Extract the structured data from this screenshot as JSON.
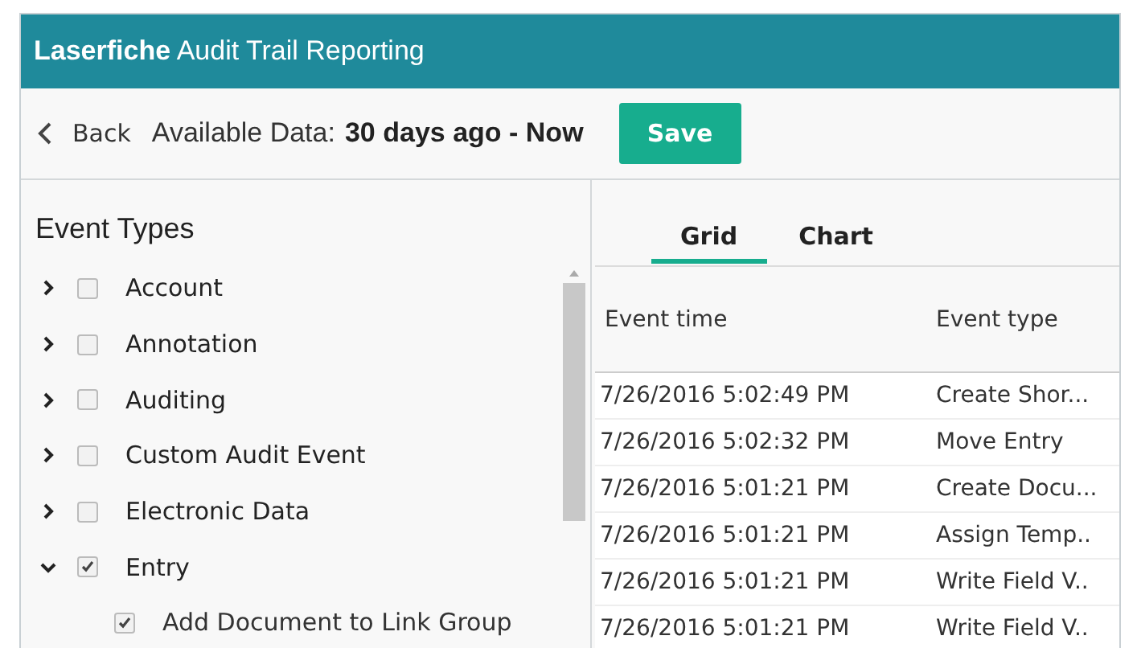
{
  "window": {
    "title": "**Laserfiche** Audit Trail Reporting"
  },
  "toolbar": {
    "back": "Back",
    "range_label": "Available Data:",
    "range_value": "30 days ago - Now",
    "save": "Save"
  },
  "event_types": {
    "title": "Event Types",
    "items": [
      {
        "label": "Account",
        "expanded": false,
        "checked": false
      },
      {
        "label": "Annotation",
        "expanded": false,
        "checked": false
      },
      {
        "label": "Auditing",
        "expanded": false,
        "checked": false
      },
      {
        "label": "Custom Audit Event",
        "expanded": false,
        "checked": false
      },
      {
        "label": "Electronic Data",
        "expanded": false,
        "checked": false
      },
      {
        "label": "Entry",
        "expanded": true,
        "checked": true,
        "children": [
          {
            "label": "Add Document to Link Group",
            "checked": true
          }
        ]
      }
    ]
  },
  "tabs": [
    {
      "label": "Grid",
      "selected": true
    },
    {
      "label": "Chart",
      "selected": false
    }
  ],
  "table": {
    "columns": [
      "Event time",
      "Event type"
    ],
    "rows": [
      [
        "7/26/2016 5:02:49 PM",
        "Create Shor..."
      ],
      [
        "7/26/2016 5:02:32 PM",
        "Move Entry"
      ],
      [
        "7/26/2016 5:01:21 PM",
        "Create Docu..."
      ],
      [
        "7/26/2016 5:01:21 PM",
        "Assign Temp.."
      ],
      [
        "7/26/2016 5:01:21 PM",
        "Write Field V.."
      ],
      [
        "7/26/2016 5:01:21 PM",
        "Write Field V.."
      ]
    ]
  }
}
